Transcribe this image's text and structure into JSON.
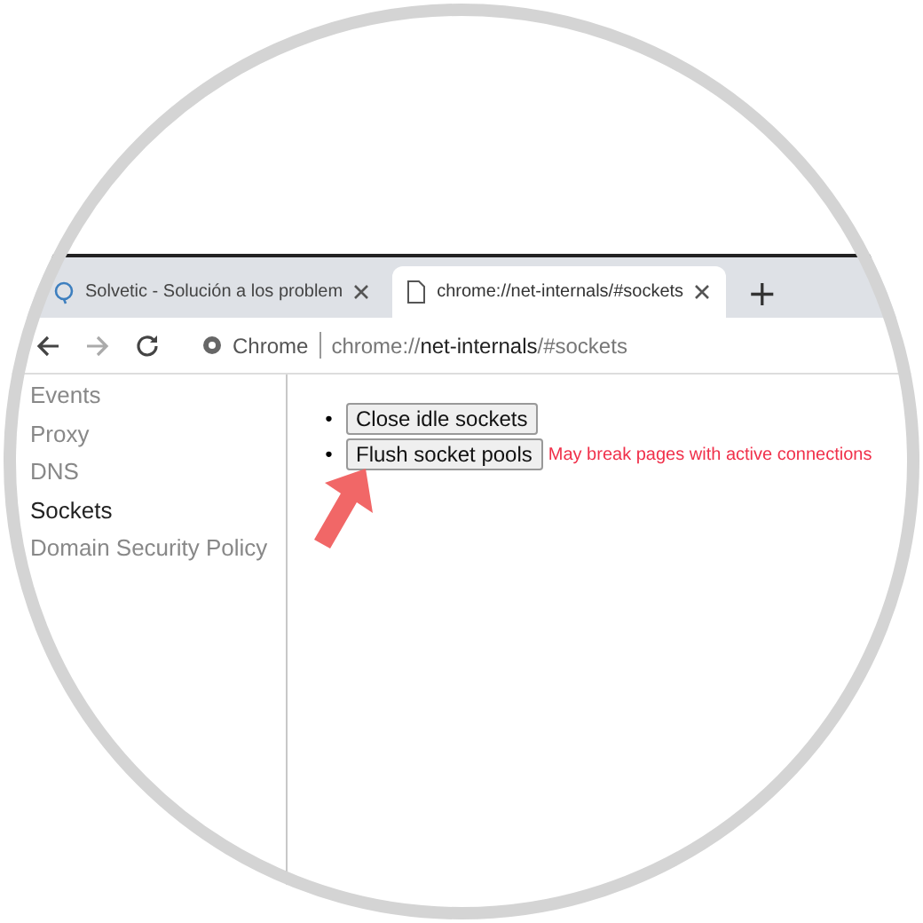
{
  "tabs": [
    {
      "title": "Solvetic - Solución a los problem",
      "kind": "site",
      "selected": false
    },
    {
      "title": "chrome://net-internals/#sockets",
      "kind": "page",
      "selected": true
    }
  ],
  "new_tab": "+",
  "address": {
    "chip": "Chrome",
    "url": "chrome://**net-internals**/#sockets"
  },
  "sidebar": {
    "items": [
      {
        "label": "Events",
        "selected": false
      },
      {
        "label": "Proxy",
        "selected": false
      },
      {
        "label": "DNS",
        "selected": false
      },
      {
        "label": "Sockets",
        "selected": true
      },
      {
        "label": "Domain Security Policy",
        "selected": false
      }
    ]
  },
  "actions": [
    {
      "bullet": "•",
      "label": "Close idle sockets"
    },
    {
      "bullet": "•",
      "label": "Flush socket pools",
      "warning": "May break pages with active connections"
    }
  ]
}
